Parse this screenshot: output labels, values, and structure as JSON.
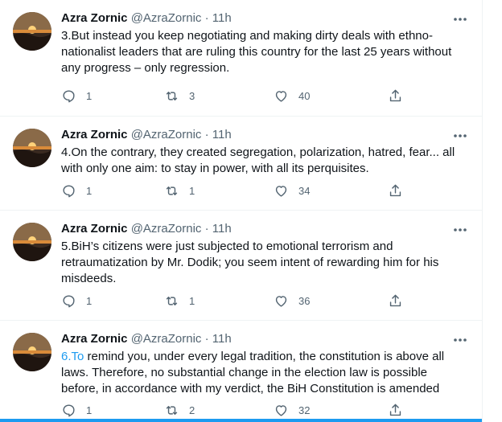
{
  "tweets": [
    {
      "name": "Azra Zornic",
      "handle": "@AzraZornic",
      "dot": "·",
      "time": "11h",
      "link": "",
      "text": "3.But instead you keep negotiating and making dirty deals with ethno-nationalist leaders that are ruling this country for the last 25 years without any progress – only regression.",
      "replies": "1",
      "retweets": "3",
      "likes": "40"
    },
    {
      "name": "Azra Zornic",
      "handle": "@AzraZornic",
      "dot": "·",
      "time": "11h",
      "link": "",
      "text": "4.On the contrary, they created segregation, polarization, hatred, fear... all with only one aim: to stay in power, with all its perquisites.",
      "replies": "1",
      "retweets": "1",
      "likes": "34"
    },
    {
      "name": "Azra Zornic",
      "handle": "@AzraZornic",
      "dot": "·",
      "time": "11h",
      "link": "",
      "text": "5.BiH’s citizens were just subjected to emotional terrorism and retraumatization by Mr. Dodik; you seem intent of rewarding him for his misdeeds.",
      "replies": "1",
      "retweets": "1",
      "likes": "36"
    },
    {
      "name": "Azra Zornic",
      "handle": "@AzraZornic",
      "dot": "·",
      "time": "11h",
      "link": "6.To",
      "text": " remind you, under every legal tradition, the constitution is above all laws. Therefore, no substantial change in the election law is possible before, in accordance with my verdict, the BiH Constitution is amended",
      "replies": "1",
      "retweets": "2",
      "likes": "32"
    }
  ],
  "colors": {
    "text": "#0f1419",
    "secondary": "#536471",
    "accent": "#1d9bf0",
    "divider": "#eff3f4"
  },
  "icons": [
    "sunset-avatar",
    "more-icon",
    "reply-icon",
    "retweet-icon",
    "like-icon",
    "share-icon"
  ]
}
